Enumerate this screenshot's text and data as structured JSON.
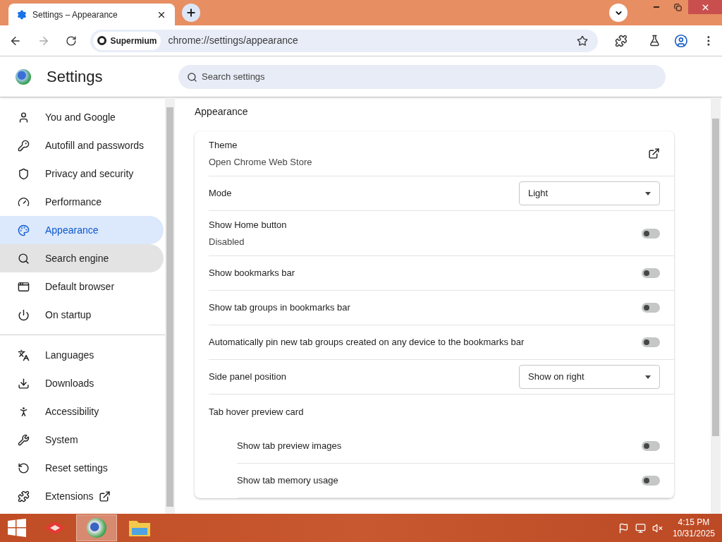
{
  "browser": {
    "tab_title": "Settings – Appearance",
    "site_chip": "Supermium",
    "url": "chrome://settings/appearance"
  },
  "header": {
    "title": "Settings",
    "search_placeholder": "Search settings"
  },
  "sidebar": {
    "groups": [
      [
        {
          "kind": "page",
          "label": "You and Google",
          "selected": false,
          "hovered": false
        },
        {
          "kind": "page",
          "label": "Autofill and passwords",
          "selected": false,
          "hovered": false
        },
        {
          "kind": "page",
          "label": "Privacy and security",
          "selected": false,
          "hovered": false
        },
        {
          "kind": "page",
          "label": "Performance",
          "selected": false,
          "hovered": false
        },
        {
          "kind": "page",
          "label": "Appearance",
          "selected": true,
          "hovered": false
        },
        {
          "kind": "page",
          "label": "Search engine",
          "selected": false,
          "hovered": true
        },
        {
          "kind": "page",
          "label": "Default browser",
          "selected": false,
          "hovered": false
        },
        {
          "kind": "page",
          "label": "On startup",
          "selected": false,
          "hovered": false
        }
      ],
      [
        {
          "kind": "page",
          "label": "Languages",
          "selected": false,
          "hovered": false
        },
        {
          "kind": "page",
          "label": "Downloads",
          "selected": false,
          "hovered": false
        },
        {
          "kind": "page",
          "label": "Accessibility",
          "selected": false,
          "hovered": false
        },
        {
          "kind": "page",
          "label": "System",
          "selected": false,
          "hovered": false
        },
        {
          "kind": "page",
          "label": "Reset settings",
          "selected": false,
          "hovered": false
        },
        {
          "kind": "external",
          "label": "Extensions",
          "selected": false,
          "hovered": false
        }
      ]
    ]
  },
  "section": {
    "title": "Appearance",
    "rows": [
      {
        "kind": "link",
        "label": "Theme",
        "sublabel": "Open Chrome Web Store"
      },
      {
        "kind": "select",
        "label": "Mode",
        "value": "Light"
      },
      {
        "kind": "toggle",
        "label": "Show Home button",
        "sublabel": "Disabled",
        "on": false
      },
      {
        "kind": "toggle",
        "label": "Show bookmarks bar",
        "on": false
      },
      {
        "kind": "toggle",
        "label": "Show tab groups in bookmarks bar",
        "on": false
      },
      {
        "kind": "toggle",
        "label": "Automatically pin new tab groups created on any device to the bookmarks bar",
        "on": false
      },
      {
        "kind": "select",
        "label": "Side panel position",
        "value": "Show on right"
      },
      {
        "kind": "heading",
        "label": "Tab hover preview card",
        "children": [
          {
            "kind": "toggle",
            "label": "Show tab preview images",
            "on": false
          },
          {
            "kind": "toggle",
            "label": "Show tab memory usage",
            "on": false
          }
        ]
      }
    ]
  },
  "taskbar": {
    "time": "4:15 PM",
    "date": "10/31/2025"
  }
}
